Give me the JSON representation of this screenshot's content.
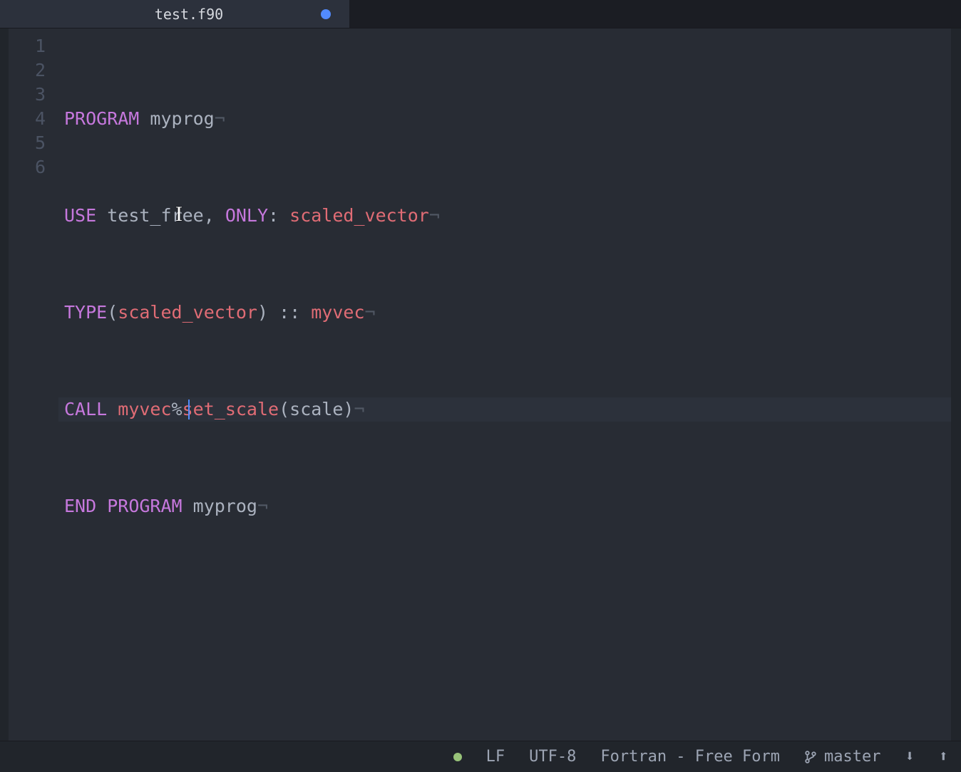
{
  "tab": {
    "title": "test.f90",
    "modified_color": "#528bff"
  },
  "gutter": [
    "1",
    "2",
    "3",
    "4",
    "5",
    "6"
  ],
  "code": {
    "l1": {
      "kw": "PROGRAM",
      "id": "myprog"
    },
    "l2": {
      "kw": "USE",
      "mod": "test_free",
      "comma": ",",
      "only_kw": "ONLY",
      "colon": ":",
      "sym": "scaled_vector"
    },
    "l3": {
      "kw": "TYPE",
      "lp": "(",
      "type": "scaled_vector",
      "rp": ")",
      "dcolon": " :: ",
      "var": "myvec"
    },
    "l4": {
      "kw": "CALL",
      "obj": "myvec",
      "pct": "%",
      "s": "s",
      "rest": "et_scale",
      "lp": "(",
      "arg": "scale",
      "rp": ")"
    },
    "l5": {
      "kw1": "END",
      "kw2": "PROGRAM",
      "id": "myprog"
    }
  },
  "soft_return": "¬",
  "status": {
    "line_ending": "LF",
    "encoding": "UTF-8",
    "language": "Fortran - Free Form",
    "branch": "master",
    "down": "⬇",
    "up": "⬆"
  },
  "icons": {
    "branch": "git-branch-icon"
  }
}
